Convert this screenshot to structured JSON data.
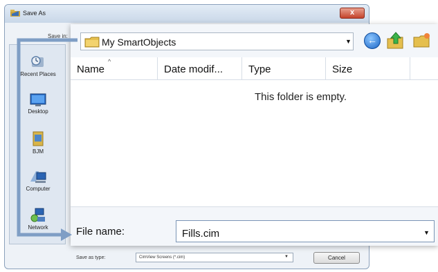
{
  "dialog": {
    "title": "Save As",
    "close_label": "x",
    "save_in_label": "Save in:"
  },
  "places": [
    {
      "label": "Recent Places",
      "icon": "recent-places-icon"
    },
    {
      "label": "Desktop",
      "icon": "desktop-icon"
    },
    {
      "label": "BJM",
      "icon": "user-folder-icon"
    },
    {
      "label": "Computer",
      "icon": "computer-icon"
    },
    {
      "label": "Network",
      "icon": "network-icon"
    }
  ],
  "toolbar": {
    "save_in_value": "My SmartObjects",
    "back_glyph": "←"
  },
  "columns": [
    "Name",
    "Date modif...",
    "Type",
    "Size"
  ],
  "file_list": {
    "empty_message": "This folder is empty."
  },
  "file_name": {
    "label": "File name:",
    "value": "Fills.cim"
  },
  "save_as_type": {
    "label": "Save as type:",
    "value": "CimView Screens (*.cim)"
  },
  "buttons": {
    "cancel": "Cancel"
  },
  "colors": {
    "accent_arrow": "#7f9ec5",
    "title_gradient_top": "#e3ecf6",
    "close_red": "#c4432b"
  }
}
